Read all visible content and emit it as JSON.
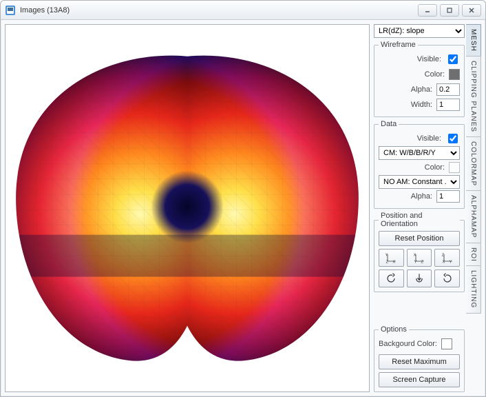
{
  "window": {
    "title": "Images (13A8)"
  },
  "top_selector": {
    "value": "LR(dZ): slope"
  },
  "wireframe": {
    "legend": "Wireframe",
    "visible_label": "Visible:",
    "visible_checked": true,
    "color_label": "Color:",
    "color_value": "#555555",
    "alpha_label": "Alpha:",
    "alpha_value": "0.2",
    "width_label": "Width:",
    "width_value": "1"
  },
  "data": {
    "legend": "Data",
    "visible_label": "Visible:",
    "visible_checked": true,
    "cm_value": "CM: W/B/B/R/Y",
    "color_label": "Color:",
    "am_value": "NO AM: Constant .",
    "alpha_label": "Alpha:",
    "alpha_value": "1"
  },
  "pos": {
    "legend": "Position and Orientation",
    "reset_label": "Reset Position"
  },
  "options": {
    "legend": "Options",
    "bg_label": "Backgourd Color:",
    "reset_max_label": "Reset Maximum",
    "screen_capture_label": "Screen Capture"
  },
  "vtabs": {
    "mesh": "MESH",
    "clipping": "CLIPPING PLANES",
    "colormap": "COLORMAP",
    "alphamap": "ALPHAMAP",
    "roi": "ROI",
    "lighting": "LIGHTING"
  },
  "axis_btns": {
    "yzx": "Y Z X",
    "xyz": "X Y Z",
    "zxy": "Z X Y"
  }
}
